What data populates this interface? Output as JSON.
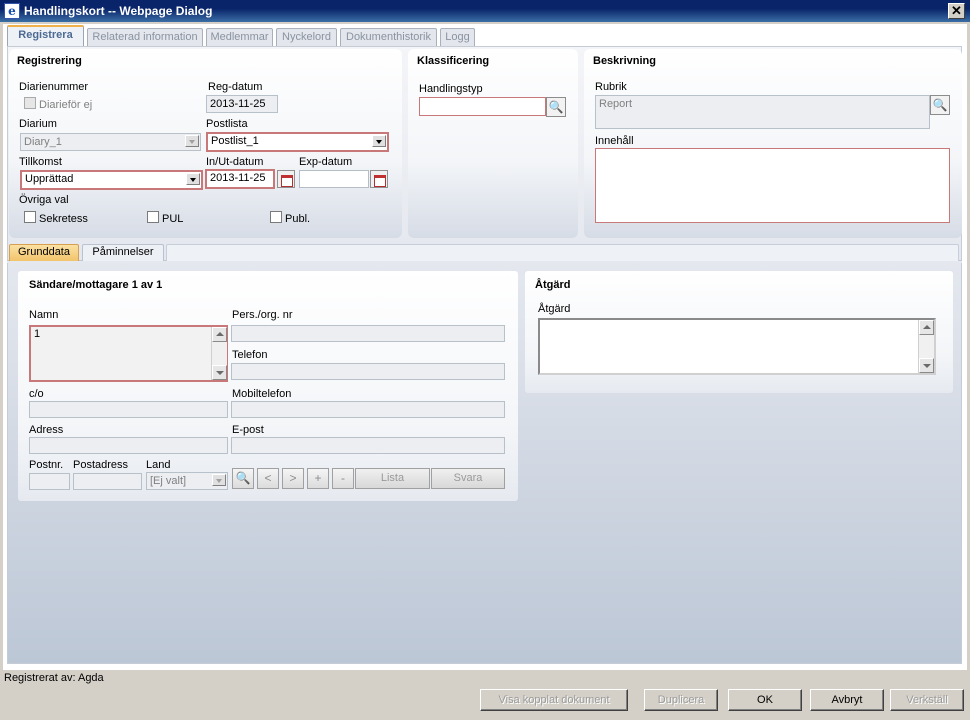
{
  "window": {
    "title": "Handlingskort -- Webpage Dialog",
    "close_glyph": "✕",
    "app_icon": "ie-icon"
  },
  "tabs": [
    {
      "label": "Registrera",
      "active": true
    },
    {
      "label": "Relaterad information"
    },
    {
      "label": "Medlemmar"
    },
    {
      "label": "Nyckelord"
    },
    {
      "label": "Dokumenthistorik"
    },
    {
      "label": "Logg"
    }
  ],
  "registrering": {
    "title": "Registrering",
    "diarienummer_label": "Diarienummer",
    "diarifor_ej_label": "Diarieför ej",
    "reg_datum_label": "Reg-datum",
    "reg_datum_value": "2013-11-25",
    "diarium_label": "Diarium",
    "diarium_value": "Diary_1",
    "postlista_label": "Postlista",
    "postlista_value": "Postlist_1",
    "tillkomst_label": "Tillkomst",
    "tillkomst_value": "Upprättad",
    "in_ut_datum_label": "In/Ut-datum",
    "in_ut_datum_value": "2013-11-25",
    "exp_datum_label": "Exp-datum",
    "exp_datum_value": "",
    "ovriga_val_label": "Övriga val",
    "sekretess_label": "Sekretess",
    "pul_label": "PUL",
    "publ_label": "Publ."
  },
  "klassificering": {
    "title": "Klassificering",
    "handlingstyp_label": "Handlingstyp",
    "handlingstyp_value": ""
  },
  "beskrivning": {
    "title": "Beskrivning",
    "rubrik_label": "Rubrik",
    "rubrik_value": "Report",
    "innehall_label": "Innehåll",
    "innehall_value": ""
  },
  "subtabs": [
    {
      "label": "Grunddata",
      "active": true
    },
    {
      "label": "Påminnelser"
    }
  ],
  "sandare": {
    "title": "Sändare/mottagare 1 av 1",
    "namn_label": "Namn",
    "namn_value": "1",
    "pers_org_label": "Pers./org. nr",
    "telefon_label": "Telefon",
    "co_label": "c/o",
    "mobiltelefon_label": "Mobiltelefon",
    "adress_label": "Adress",
    "epost_label": "E-post",
    "postnr_label": "Postnr.",
    "postadress_label": "Postadress",
    "land_label": "Land",
    "land_value": "[Ej valt]",
    "prev_glyph": "<",
    "next_glyph": ">",
    "add_glyph": "+",
    "remove_glyph": "-",
    "lista_label": "Lista",
    "svara_label": "Svara"
  },
  "atgard": {
    "title": "Åtgärd",
    "field_label": "Åtgärd",
    "value": ""
  },
  "footer": {
    "registrerat_av": "Registrerat av: Agda",
    "visa_kopplat": "Visa kopplat dokument",
    "duplicera": "Duplicera",
    "ok": "OK",
    "avbryt": "Avbryt",
    "verkstall": "Verkställ"
  },
  "icons": {
    "search": "🔍",
    "calendar": "calendar-icon"
  },
  "colors": {
    "title_bar": "#0a246a",
    "required_border": "#c87878",
    "active_tab_accent": "#f0b04a"
  }
}
